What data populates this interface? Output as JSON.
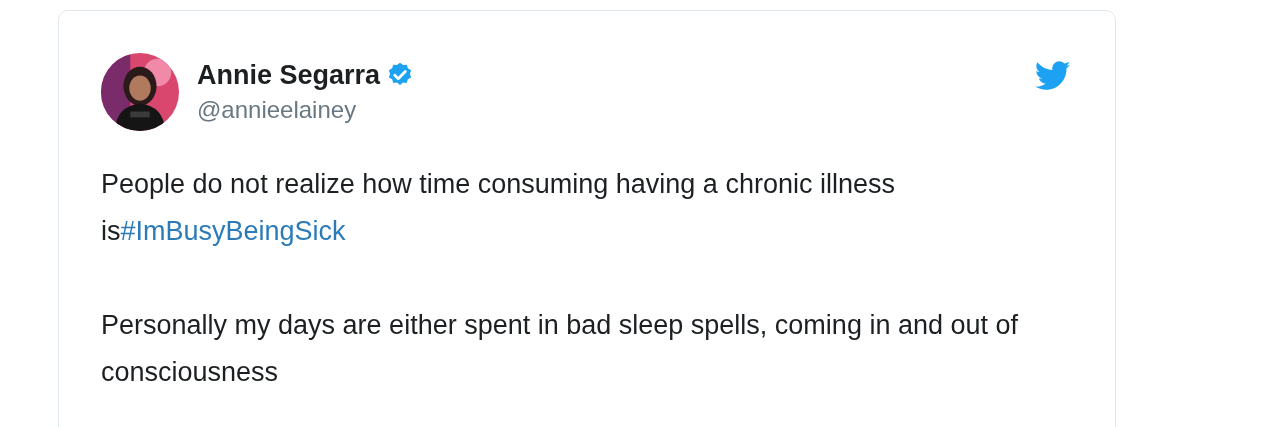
{
  "author": {
    "name": "Annie Segarra",
    "verified": true,
    "handle": "@annieelainey"
  },
  "paragraphs": [
    {
      "parts": [
        {
          "kind": "text",
          "text": "People do not realize how time consuming having a chronic illness is"
        },
        {
          "kind": "hashtag",
          "text": "#ImBusyBeingSick"
        }
      ]
    },
    {
      "parts": [
        {
          "kind": "text",
          "text": "Personally my days are either spent in bad sleep spells, coming in and out of consciousness"
        }
      ]
    }
  ]
}
